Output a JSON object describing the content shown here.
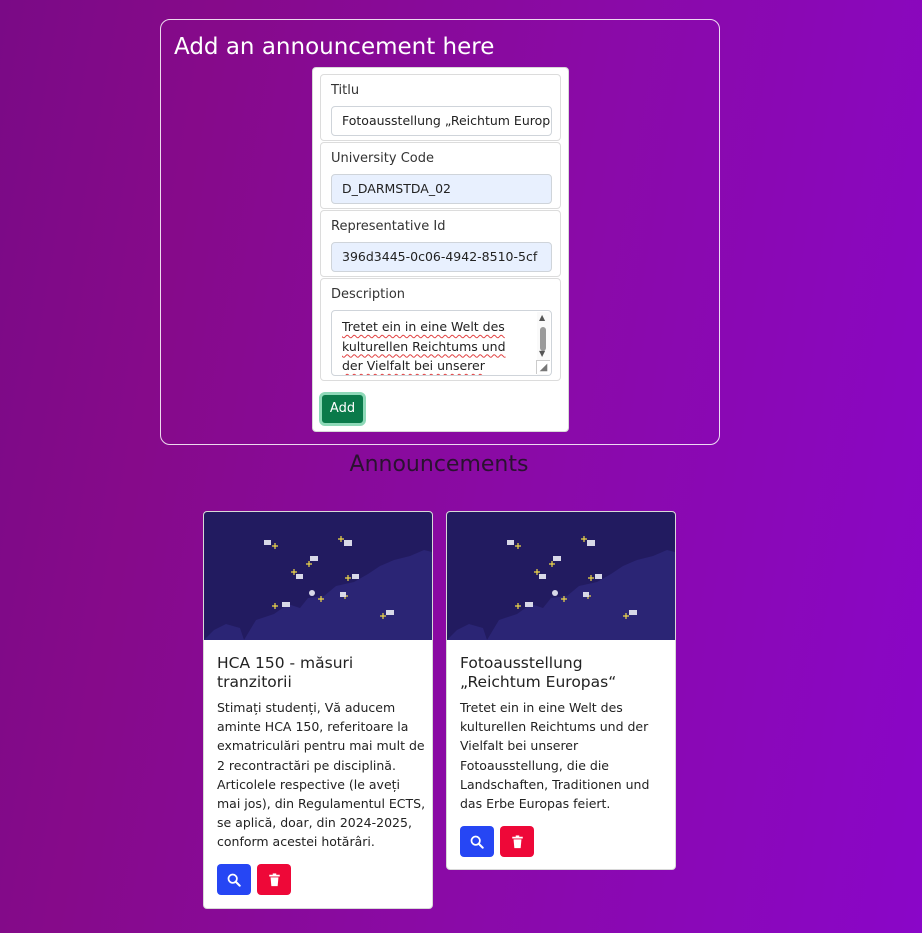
{
  "form": {
    "heading": "Add an announcement here",
    "title_label": "Titlu",
    "title_value": "Fotoausstellung „Reichtum Europ",
    "university_label": "University Code",
    "university_value": "D_DARMSTDA_02",
    "representative_label": "Representative Id",
    "representative_value": "396d3445-0c06-4942-8510-5cf",
    "description_label": "Description",
    "description_value": "Tretet ein in eine Welt des kulturellen Reichtums und der Vielfalt bei unserer",
    "add_label": "Add"
  },
  "announcements": {
    "heading": "Announcements",
    "cards": [
      {
        "title": "HCA 150 - măsuri tranzitorii",
        "text": "Stimați studenți, Vă aducem aminte HCA 150, referitoare la exmatriculări pentru mai mult de 2 recontractări pe disciplină. Articolele respective (le aveți mai jos), din Regulamentul ECTS, se aplică, doar, din 2024-2025, conform acestei hotărâri."
      },
      {
        "title": "Fotoausstellung „Reichtum Europas“",
        "text": "Tretet ein in eine Welt des kulturellen Reichtums und der Vielfalt bei unserer Fotoausstellung, die die Landschaften, Traditionen und das Erbe Europas feiert."
      }
    ]
  },
  "icons": {
    "search": "search-icon",
    "delete": "trash-icon",
    "image": "europe-map-image"
  },
  "colors": {
    "add_button": "#0a7a4a",
    "search_button": "#2646f4",
    "delete_button": "#ee0838",
    "map_background": "#221b60"
  }
}
